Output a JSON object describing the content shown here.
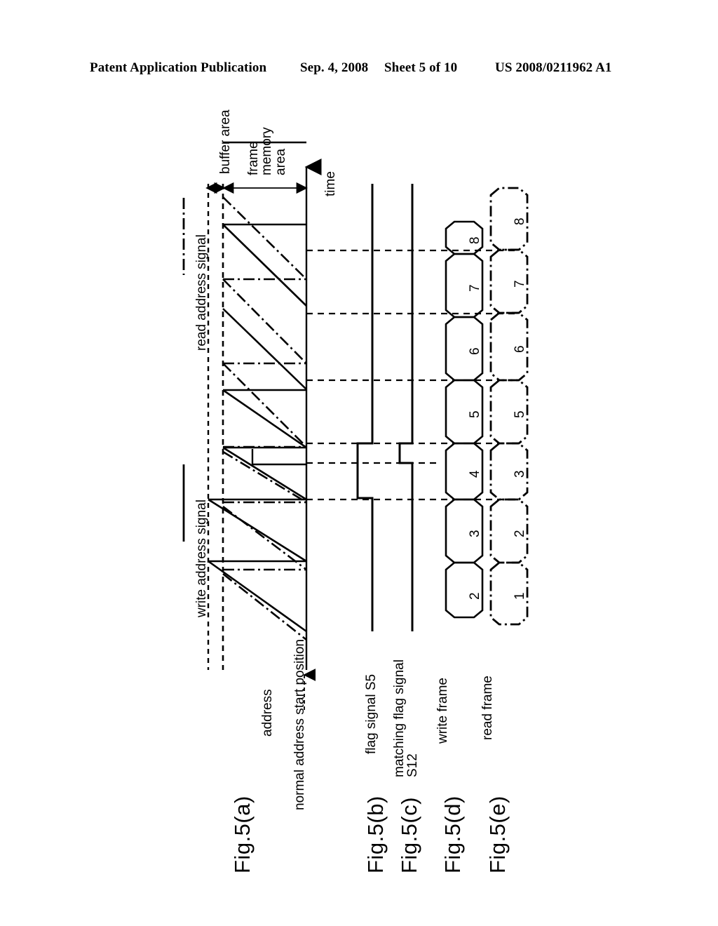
{
  "header": {
    "publication": "Patent Application Publication",
    "date": "Sep. 4, 2008",
    "sheet": "Sheet 5 of 10",
    "number": "US 2008/0211962 A1"
  },
  "figure": {
    "id": "Fig.5",
    "subfigures": [
      {
        "id": "Fig.5(a)",
        "caption": "address",
        "caption2": "normal address start position"
      },
      {
        "id": "Fig.5(b)",
        "caption": "flag signal S5"
      },
      {
        "id": "Fig.5(c)",
        "caption": "matching flag signal",
        "caption2": "S12"
      },
      {
        "id": "Fig.5(d)",
        "caption": "write frame"
      },
      {
        "id": "Fig.5(e)",
        "caption": "read frame"
      }
    ],
    "legend": [
      {
        "key": "write",
        "label": "write address signal",
        "style": "solid"
      },
      {
        "key": "read",
        "label": "read address signal",
        "style": "dash-dot"
      }
    ],
    "axis_labels": {
      "time": "time",
      "buffer_area": "buffer area",
      "frame_memory_area": "frame\nmemory\narea",
      "frame_memory_line1": "frame",
      "frame_memory_line2": "memory",
      "frame_memory_line3": "area"
    },
    "write_frames": [
      "8",
      "7",
      "6",
      "5",
      "4",
      "3",
      "2"
    ],
    "read_frames": [
      "8",
      "7",
      "6",
      "5",
      "3",
      "2",
      "1"
    ]
  },
  "colors": {
    "ink": "#000000",
    "paper": "#ffffff"
  }
}
